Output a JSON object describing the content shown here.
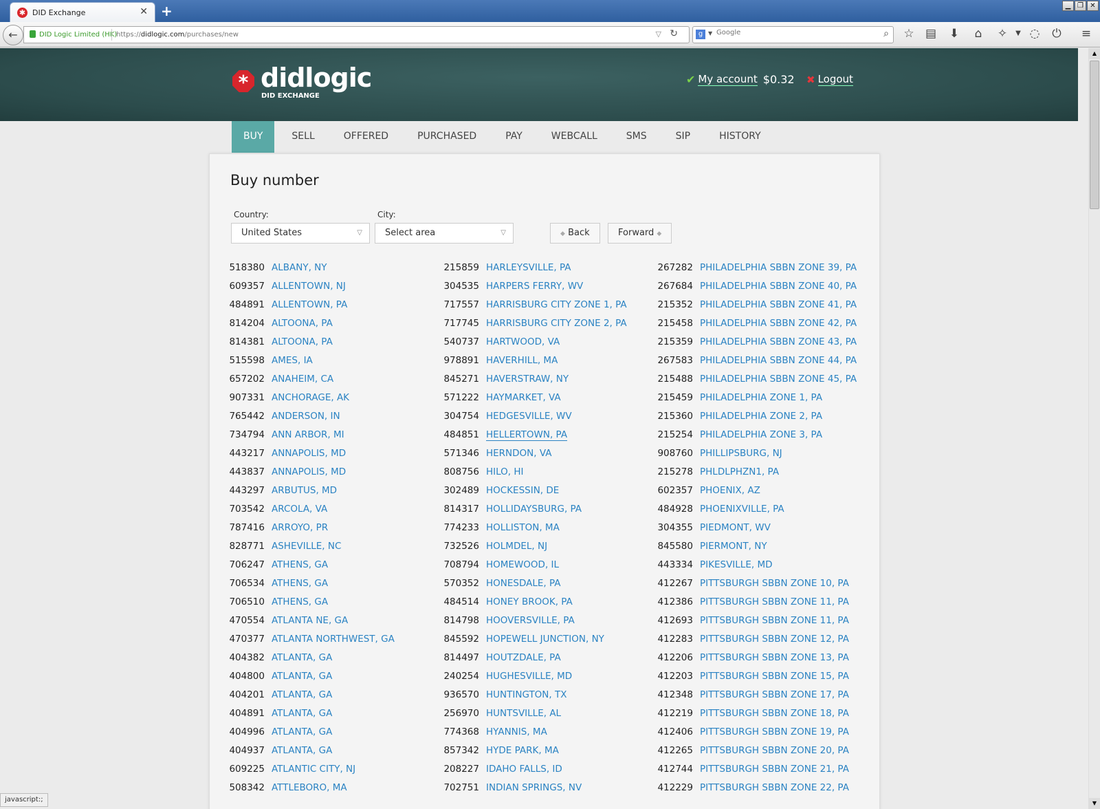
{
  "browser": {
    "tab_title": "DID Exchange",
    "identity": "DID Logic Limited (HK)",
    "url_prefix": "https://",
    "url_domain": "didlogic.com",
    "url_path": "/purchases/new",
    "search_placeholder": "Google",
    "status_text": "javascript:;"
  },
  "header": {
    "logo_text": "didlogic",
    "logo_sub": "DID EXCHANGE",
    "account_label": "My account",
    "balance": "$0.32",
    "logout_label": "Logout"
  },
  "nav": [
    {
      "label": "BUY",
      "active": true
    },
    {
      "label": "SELL"
    },
    {
      "label": "OFFERED"
    },
    {
      "label": "PURCHASED"
    },
    {
      "label": "PAY"
    },
    {
      "label": "WEBCALL"
    },
    {
      "label": "SMS"
    },
    {
      "label": "SIP"
    },
    {
      "label": "HISTORY"
    }
  ],
  "page": {
    "title": "Buy number",
    "country_label": "Country:",
    "country_value": "United States",
    "city_label": "City:",
    "city_value": "Select area",
    "back_label": "Back",
    "forward_label": "Forward"
  },
  "columns": [
    [
      {
        "code": "518380",
        "city": "ALBANY, NY"
      },
      {
        "code": "609357",
        "city": "ALLENTOWN, NJ"
      },
      {
        "code": "484891",
        "city": "ALLENTOWN, PA"
      },
      {
        "code": "814204",
        "city": "ALTOONA, PA"
      },
      {
        "code": "814381",
        "city": "ALTOONA, PA"
      },
      {
        "code": "515598",
        "city": "AMES, IA"
      },
      {
        "code": "657202",
        "city": "ANAHEIM, CA"
      },
      {
        "code": "907331",
        "city": "ANCHORAGE, AK"
      },
      {
        "code": "765442",
        "city": "ANDERSON, IN"
      },
      {
        "code": "734794",
        "city": "ANN ARBOR, MI"
      },
      {
        "code": "443217",
        "city": "ANNAPOLIS, MD"
      },
      {
        "code": "443837",
        "city": "ANNAPOLIS, MD"
      },
      {
        "code": "443297",
        "city": "ARBUTUS, MD"
      },
      {
        "code": "703542",
        "city": "ARCOLA, VA"
      },
      {
        "code": "787416",
        "city": "ARROYO, PR"
      },
      {
        "code": "828771",
        "city": "ASHEVILLE, NC"
      },
      {
        "code": "706247",
        "city": "ATHENS, GA"
      },
      {
        "code": "706534",
        "city": "ATHENS, GA"
      },
      {
        "code": "706510",
        "city": "ATHENS, GA"
      },
      {
        "code": "470554",
        "city": "ATLANTA NE, GA"
      },
      {
        "code": "470377",
        "city": "ATLANTA NORTHWEST, GA"
      },
      {
        "code": "404382",
        "city": "ATLANTA, GA"
      },
      {
        "code": "404800",
        "city": "ATLANTA, GA"
      },
      {
        "code": "404201",
        "city": "ATLANTA, GA"
      },
      {
        "code": "404891",
        "city": "ATLANTA, GA"
      },
      {
        "code": "404996",
        "city": "ATLANTA, GA"
      },
      {
        "code": "404937",
        "city": "ATLANTA, GA"
      },
      {
        "code": "609225",
        "city": "ATLANTIC CITY, NJ"
      },
      {
        "code": "508342",
        "city": "ATTLEBORO, MA"
      }
    ],
    [
      {
        "code": "215859",
        "city": "HARLEYSVILLE, PA"
      },
      {
        "code": "304535",
        "city": "HARPERS FERRY, WV"
      },
      {
        "code": "717557",
        "city": "HARRISBURG CITY ZONE 1, PA"
      },
      {
        "code": "717745",
        "city": "HARRISBURG CITY ZONE 2, PA"
      },
      {
        "code": "540737",
        "city": "HARTWOOD, VA"
      },
      {
        "code": "978891",
        "city": "HAVERHILL, MA"
      },
      {
        "code": "845271",
        "city": "HAVERSTRAW, NY"
      },
      {
        "code": "571222",
        "city": "HAYMARKET, VA"
      },
      {
        "code": "304754",
        "city": "HEDGESVILLE, WV"
      },
      {
        "code": "484851",
        "city": "HELLERTOWN, PA",
        "hover": true
      },
      {
        "code": "571346",
        "city": "HERNDON, VA"
      },
      {
        "code": "808756",
        "city": "HILO, HI"
      },
      {
        "code": "302489",
        "city": "HOCKESSIN, DE"
      },
      {
        "code": "814317",
        "city": "HOLLIDAYSBURG, PA"
      },
      {
        "code": "774233",
        "city": "HOLLISTON, MA"
      },
      {
        "code": "732526",
        "city": "HOLMDEL, NJ"
      },
      {
        "code": "708794",
        "city": "HOMEWOOD, IL"
      },
      {
        "code": "570352",
        "city": "HONESDALE, PA"
      },
      {
        "code": "484514",
        "city": "HONEY BROOK, PA"
      },
      {
        "code": "814798",
        "city": "HOOVERSVILLE, PA"
      },
      {
        "code": "845592",
        "city": "HOPEWELL JUNCTION, NY"
      },
      {
        "code": "814497",
        "city": "HOUTZDALE, PA"
      },
      {
        "code": "240254",
        "city": "HUGHESVILLE, MD"
      },
      {
        "code": "936570",
        "city": "HUNTINGTON, TX"
      },
      {
        "code": "256970",
        "city": "HUNTSVILLE, AL"
      },
      {
        "code": "774368",
        "city": "HYANNIS, MA"
      },
      {
        "code": "857342",
        "city": "HYDE PARK, MA"
      },
      {
        "code": "208227",
        "city": "IDAHO FALLS, ID"
      },
      {
        "code": "702751",
        "city": "INDIAN SPRINGS, NV"
      }
    ],
    [
      {
        "code": "267282",
        "city": "PHILADELPHIA SBBN ZONE 39, PA"
      },
      {
        "code": "267684",
        "city": "PHILADELPHIA SBBN ZONE 40, PA"
      },
      {
        "code": "215352",
        "city": "PHILADELPHIA SBBN ZONE 41, PA"
      },
      {
        "code": "215458",
        "city": "PHILADELPHIA SBBN ZONE 42, PA"
      },
      {
        "code": "215359",
        "city": "PHILADELPHIA SBBN ZONE 43, PA"
      },
      {
        "code": "267583",
        "city": "PHILADELPHIA SBBN ZONE 44, PA"
      },
      {
        "code": "215488",
        "city": "PHILADELPHIA SBBN ZONE 45, PA"
      },
      {
        "code": "215459",
        "city": "PHILADELPHIA ZONE 1, PA"
      },
      {
        "code": "215360",
        "city": "PHILADELPHIA ZONE 2, PA"
      },
      {
        "code": "215254",
        "city": "PHILADELPHIA ZONE 3, PA"
      },
      {
        "code": "908760",
        "city": "PHILLIPSBURG, NJ"
      },
      {
        "code": "215278",
        "city": "PHLDLPHZN1, PA"
      },
      {
        "code": "602357",
        "city": "PHOENIX, AZ"
      },
      {
        "code": "484928",
        "city": "PHOENIXVILLE, PA"
      },
      {
        "code": "304355",
        "city": "PIEDMONT, WV"
      },
      {
        "code": "845580",
        "city": "PIERMONT, NY"
      },
      {
        "code": "443334",
        "city": "PIKESVILLE, MD"
      },
      {
        "code": "412267",
        "city": "PITTSBURGH SBBN ZONE 10, PA"
      },
      {
        "code": "412386",
        "city": "PITTSBURGH SBBN ZONE 11, PA"
      },
      {
        "code": "412693",
        "city": "PITTSBURGH SBBN ZONE 11, PA"
      },
      {
        "code": "412283",
        "city": "PITTSBURGH SBBN ZONE 12, PA"
      },
      {
        "code": "412206",
        "city": "PITTSBURGH SBBN ZONE 13, PA"
      },
      {
        "code": "412203",
        "city": "PITTSBURGH SBBN ZONE 15, PA"
      },
      {
        "code": "412348",
        "city": "PITTSBURGH SBBN ZONE 17, PA"
      },
      {
        "code": "412219",
        "city": "PITTSBURGH SBBN ZONE 18, PA"
      },
      {
        "code": "412406",
        "city": "PITTSBURGH SBBN ZONE 19, PA"
      },
      {
        "code": "412265",
        "city": "PITTSBURGH SBBN ZONE 20, PA"
      },
      {
        "code": "412744",
        "city": "PITTSBURGH SBBN ZONE 21, PA"
      },
      {
        "code": "412229",
        "city": "PITTSBURGH SBBN ZONE 22, PA"
      }
    ]
  ]
}
